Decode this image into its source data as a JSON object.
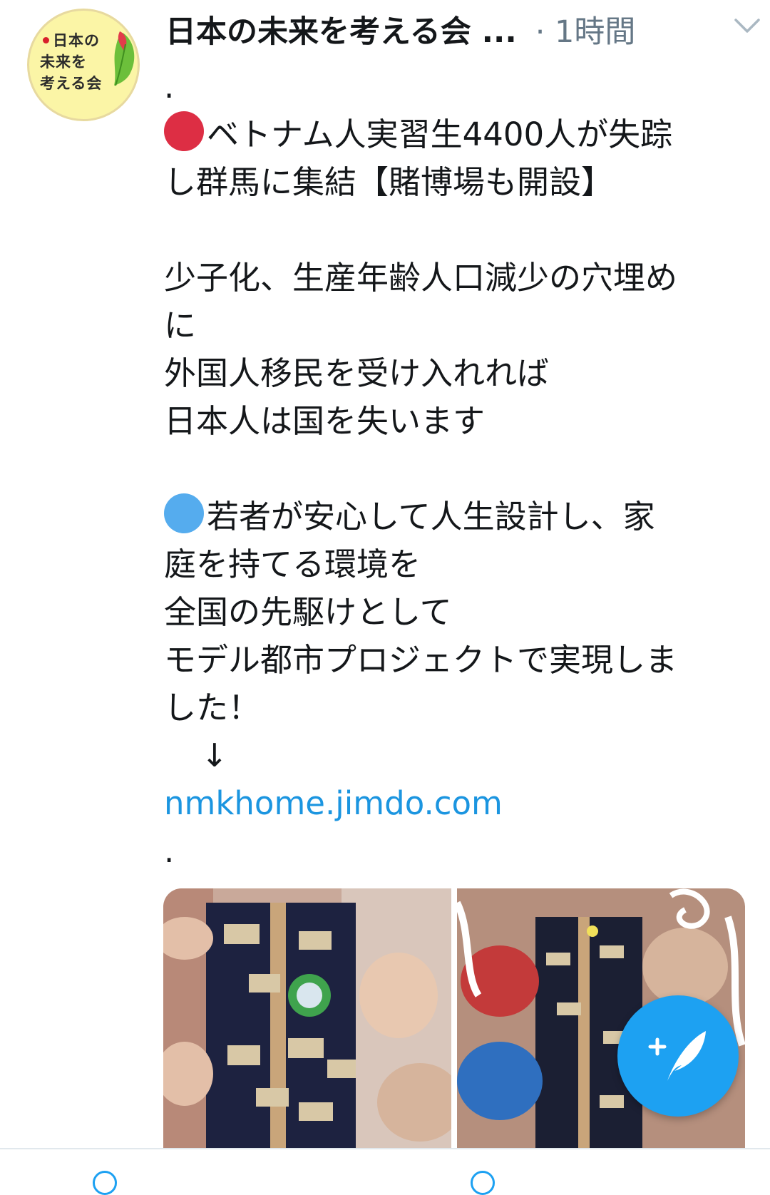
{
  "tweet": {
    "display_name": "日本の未来を考える会 ...",
    "timestamp": "· 1時間",
    "avatar": {
      "lines": [
        "日本の",
        "未来を",
        "考える会"
      ],
      "bg_color": "#fbf5a6"
    },
    "text": {
      "line1": ".",
      "line2": "ベトナム人実習生4400人が失踪",
      "line3": "し群馬に集結【賭博場も開設】",
      "line4": "少子化、生産年齢人口減少の穴埋め",
      "line5": "に",
      "line6": "外国人移民を受け入れれば",
      "line7": "日本人は国を失います",
      "line8": "若者が安心して人生設計し、家",
      "line9": "庭を持てる環境を",
      "line10": "全国の先駆けとして",
      "line11": "モデル都市プロジェクトで実現しま",
      "line12": "した！",
      "line13": "↓",
      "link": "nmkhome.jimdo.com",
      "line15": "."
    },
    "icons": {
      "bullet_red": "red-circle-icon",
      "bullet_blue": "blue-circle-icon",
      "caret": "chevron-down-icon",
      "compose": "compose-tweet-icon"
    },
    "colors": {
      "link": "#1b95e0",
      "accent": "#1da1f2",
      "muted": "#657786",
      "red_bullet": "#dd2e44",
      "blue_bullet": "#55acee"
    }
  }
}
